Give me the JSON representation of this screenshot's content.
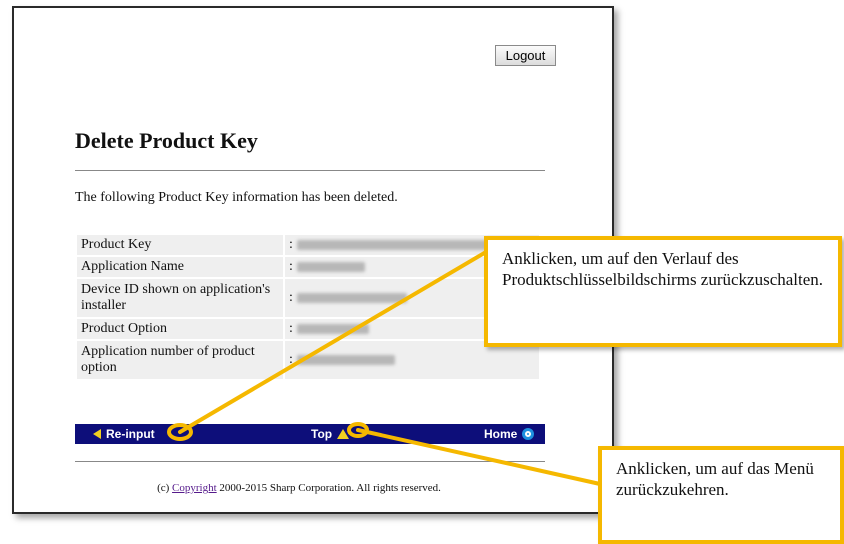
{
  "header": {
    "logout_label": "Logout"
  },
  "page": {
    "title": "Delete Product Key",
    "message": "The following Product Key information has been deleted."
  },
  "info_table": {
    "rows": [
      {
        "label": "Product Key",
        "value": ":"
      },
      {
        "label": "Application Name",
        "value": ":"
      },
      {
        "label": "Device ID shown on application's installer",
        "value": ":"
      },
      {
        "label": "Product Option",
        "value": ":"
      },
      {
        "label": "Application number of product option",
        "value": ":"
      }
    ]
  },
  "nav": {
    "reinput_label": "Re-input",
    "top_label": "Top",
    "home_label": "Home"
  },
  "footer": {
    "prefix": "(c)",
    "link": "Copyright",
    "suffix": "2000-2015 Sharp Corporation. All rights reserved."
  },
  "callouts": {
    "reinput_note": "Anklicken, um auf den Verlauf des Produktschlüsselbildschirms zurückzuschalten.",
    "top_note": "Anklicken, um auf das Menü zurückzukehren."
  },
  "colors": {
    "navbar": "#0d0e7a",
    "callout_border": "#f5b800",
    "accent_icon": "#f0d020"
  }
}
